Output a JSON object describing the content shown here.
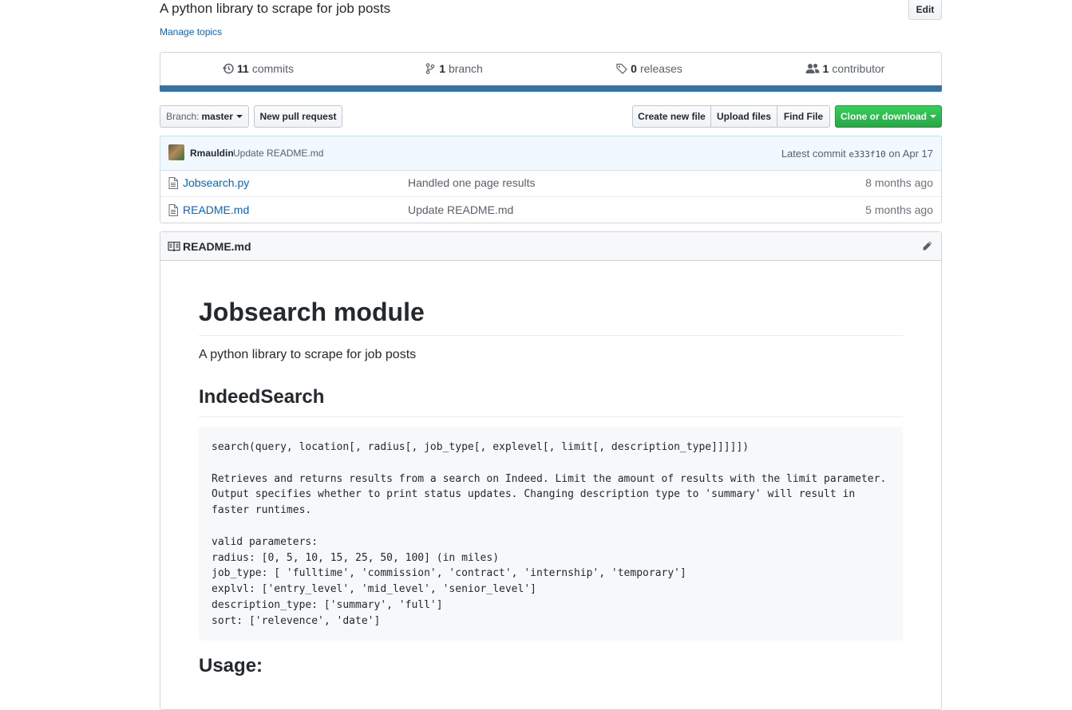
{
  "repo": {
    "description": "A python library to scrape for job posts",
    "edit_label": "Edit",
    "manage_topics": "Manage topics"
  },
  "summary": {
    "commits_count": "11",
    "commits_label": "commits",
    "branch_count": "1",
    "branch_label": "branch",
    "releases_count": "0",
    "releases_label": "releases",
    "contributors_count": "1",
    "contributors_label": "contributor",
    "language_bar_color": "#3572a5"
  },
  "toolbar": {
    "branch_prefix": "Branch:",
    "branch_name": "master",
    "new_pull_request": "New pull request",
    "create_new_file": "Create new file",
    "upload_files": "Upload files",
    "find_file": "Find File",
    "clone_or_download": "Clone or download"
  },
  "latest_commit": {
    "author": "Rmauldin",
    "message": "Update README.md",
    "label": "Latest commit",
    "sha": "e333f10",
    "date": "on Apr 17"
  },
  "files": [
    {
      "name": "Jobsearch.py",
      "message": "Handled one page results",
      "age": "8 months ago",
      "icon": "file-icon"
    },
    {
      "name": "README.md",
      "message": "Update README.md",
      "age": "5 months ago",
      "icon": "file-icon"
    }
  ],
  "readme": {
    "filename": "README.md",
    "h1": "Jobsearch module",
    "intro": "A python library to scrape for job posts",
    "h2": "IndeedSearch",
    "code": "search(query, location[, radius[, job_type[, explevel[, limit[, description_type]]]]])\n\nRetrieves and returns results from a search on Indeed. Limit the amount of results with the limit parameter.\nOutput specifies whether to print status updates. Changing description type to 'summary' will result in\nfaster runtimes.\n\nvalid parameters:\nradius: [0, 5, 10, 15, 25, 50, 100] (in miles)\njob_type: [ 'fulltime', 'commission', 'contract', 'internship', 'temporary']\nexplvl: ['entry_level', 'mid_level', 'senior_level']\ndescription_type: ['summary', 'full']\nsort: ['relevence', 'date']",
    "h2_usage": "Usage:"
  }
}
